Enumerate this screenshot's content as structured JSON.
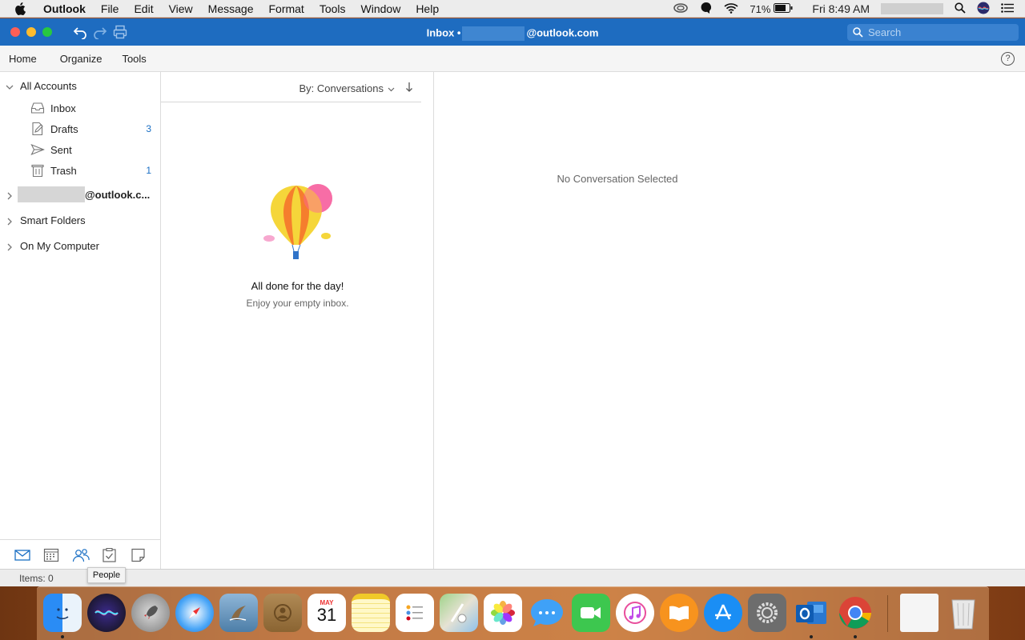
{
  "menubar": {
    "app_name": "Outlook",
    "items": [
      "File",
      "Edit",
      "View",
      "Message",
      "Format",
      "Tools",
      "Window",
      "Help"
    ],
    "battery": "71%",
    "clock": "Fri 8:49 AM"
  },
  "titlebar": {
    "title_prefix": "Inbox •",
    "title_suffix": "@outlook.com",
    "search_placeholder": "Search"
  },
  "ribbon": {
    "tabs": [
      "Home",
      "Organize",
      "Tools"
    ],
    "help": "?"
  },
  "sidebar": {
    "all_accounts": "All Accounts",
    "folders": [
      {
        "label": "Inbox",
        "count": "",
        "icon": "inbox-icon"
      },
      {
        "label": "Drafts",
        "count": "3",
        "icon": "drafts-icon"
      },
      {
        "label": "Sent",
        "count": "",
        "icon": "sent-icon"
      },
      {
        "label": "Trash",
        "count": "1",
        "icon": "trash-icon"
      }
    ],
    "account_email_suffix": "@outlook.c...",
    "smart_folders": "Smart Folders",
    "on_my_computer": "On My Computer",
    "bottom_nav": [
      "mail-icon",
      "calendar-icon",
      "people-icon",
      "tasks-icon",
      "notes-icon"
    ]
  },
  "list": {
    "sort_label": "By: Conversations",
    "empty_title": "All done for the day!",
    "empty_subtitle": "Enjoy your empty inbox."
  },
  "reading": {
    "no_selection": "No Conversation Selected"
  },
  "status": {
    "items": "Items: 0",
    "tooltip": "People"
  },
  "dock": {
    "calendar_month": "MAY",
    "calendar_day": "31",
    "apps": [
      "Finder",
      "Siri",
      "Launchpad",
      "Safari",
      "Mail",
      "Contacts",
      "Calendar",
      "Notes",
      "Reminders",
      "Maps",
      "Photos",
      "Messages",
      "FaceTime",
      "iTunes",
      "Books",
      "App Store",
      "System Preferences",
      "Outlook",
      "Chrome",
      "Documents",
      "Trash"
    ]
  }
}
